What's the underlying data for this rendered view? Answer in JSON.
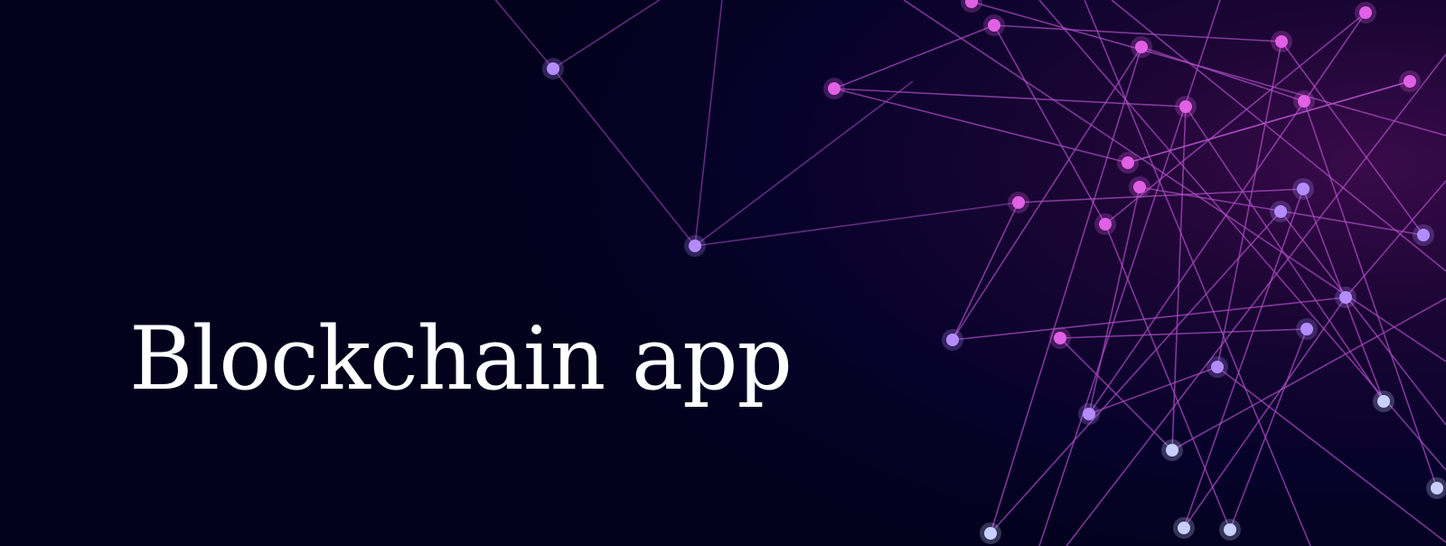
{
  "banner": {
    "title": "Blockchain app"
  },
  "colors": {
    "background": "#04011f",
    "edge": "#b04fc8",
    "node_pink": "#e060e6",
    "node_violet": "#b48cff",
    "node_blue": "#c8d0ff",
    "title_text": "#ffffff"
  },
  "graphic": {
    "icon": "blockchain-network-graphic"
  }
}
